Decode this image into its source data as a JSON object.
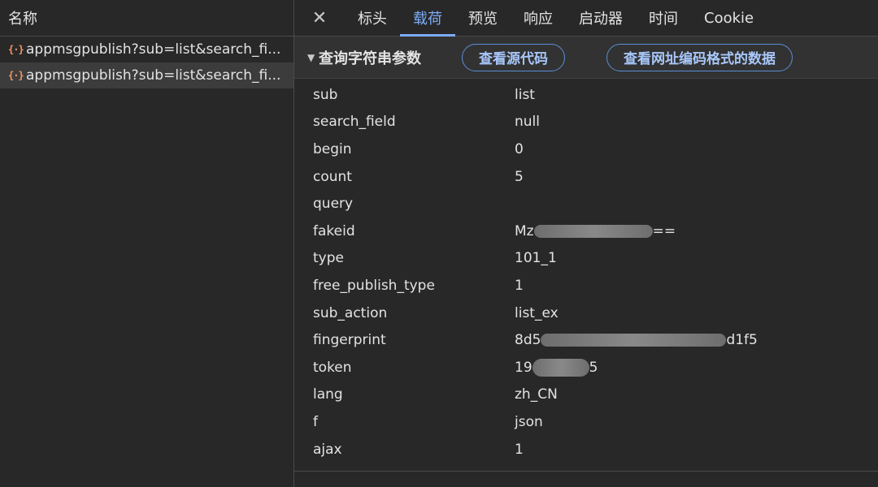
{
  "requests": {
    "column_header": "名称",
    "items": [
      {
        "icon": "json-braces-icon",
        "name": "appmsgpublish?sub=list&search_fi..."
      },
      {
        "icon": "json-braces-icon",
        "name": "appmsgpublish?sub=list&search_fi..."
      }
    ]
  },
  "tabs": {
    "close_glyph": "✕",
    "items": [
      {
        "label": "标头"
      },
      {
        "label": "载荷",
        "active": true
      },
      {
        "label": "预览"
      },
      {
        "label": "响应"
      },
      {
        "label": "启动器"
      },
      {
        "label": "时间"
      },
      {
        "label": "Cookie"
      }
    ]
  },
  "payload": {
    "section_title": "查询字符串参数",
    "view_source_label": "查看源代码",
    "view_url_encoded_label": "查看网址编码格式的数据",
    "params": [
      {
        "key": "sub",
        "value": "list"
      },
      {
        "key": "search_field",
        "value": "null"
      },
      {
        "key": "begin",
        "value": "0"
      },
      {
        "key": "count",
        "value": "5"
      },
      {
        "key": "query",
        "value": ""
      },
      {
        "key": "fakeid",
        "value_prefix": "Mz",
        "value_suffix": "==",
        "redacted": true
      },
      {
        "key": "type",
        "value": "101_1"
      },
      {
        "key": "free_publish_type",
        "value": "1"
      },
      {
        "key": "sub_action",
        "value": "list_ex"
      },
      {
        "key": "fingerprint",
        "value_prefix": "8d5",
        "value_suffix": "d1f5",
        "redacted": true
      },
      {
        "key": "token",
        "value_prefix": "19",
        "value_suffix": "5",
        "redacted": true
      },
      {
        "key": "lang",
        "value": "zh_CN"
      },
      {
        "key": "f",
        "value": "json"
      },
      {
        "key": "ajax",
        "value": "1"
      }
    ]
  },
  "colors": {
    "background": "#282828",
    "active_tab": "#7cacf8",
    "pill_border": "#5a8fd6",
    "icon_orange": "#f29766"
  }
}
